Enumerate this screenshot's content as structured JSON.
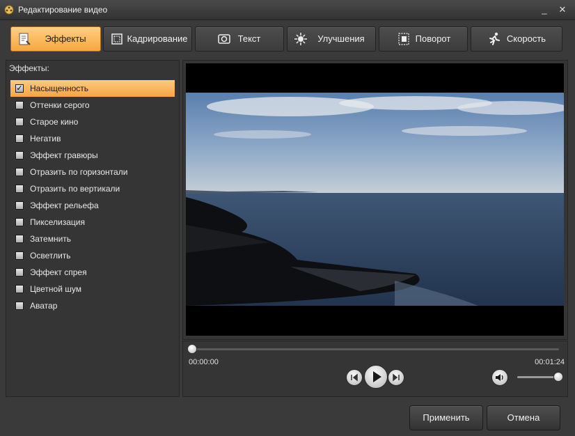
{
  "window": {
    "title": "Редактирование видео",
    "app_icon": "film-reel-icon",
    "minimize_glyph": "_",
    "close_glyph": "✕"
  },
  "tabs": [
    {
      "label": "Эффекты",
      "icon": "effects-icon",
      "active": true
    },
    {
      "label": "Кадрирование",
      "icon": "crop-icon",
      "active": false
    },
    {
      "label": "Текст",
      "icon": "text-icon",
      "active": false
    },
    {
      "label": "Улучшения",
      "icon": "brightness-icon",
      "active": false
    },
    {
      "label": "Поворот",
      "icon": "rotate-icon",
      "active": false
    },
    {
      "label": "Скорость",
      "icon": "running-man-icon",
      "active": false
    }
  ],
  "effects_panel": {
    "title": "Эффекты:",
    "items": [
      {
        "label": "Насыщенность",
        "checked": true,
        "selected": true
      },
      {
        "label": "Оттенки серого",
        "checked": false,
        "selected": false
      },
      {
        "label": "Старое кино",
        "checked": false,
        "selected": false
      },
      {
        "label": "Негатив",
        "checked": false,
        "selected": false
      },
      {
        "label": "Эффект гравюры",
        "checked": false,
        "selected": false
      },
      {
        "label": "Отразить по горизонтали",
        "checked": false,
        "selected": false
      },
      {
        "label": "Отразить по вертикали",
        "checked": false,
        "selected": false
      },
      {
        "label": "Эффект рельефа",
        "checked": false,
        "selected": false
      },
      {
        "label": "Пикселизация",
        "checked": false,
        "selected": false
      },
      {
        "label": "Затемнить",
        "checked": false,
        "selected": false
      },
      {
        "label": "Осветлить",
        "checked": false,
        "selected": false
      },
      {
        "label": "Эффект спрея",
        "checked": false,
        "selected": false
      },
      {
        "label": "Цветной шум",
        "checked": false,
        "selected": false
      },
      {
        "label": "Аватар",
        "checked": false,
        "selected": false
      }
    ]
  },
  "player": {
    "current_time": "00:00:00",
    "total_time": "00:01:24",
    "progress": 0,
    "volume": 1.0
  },
  "buttons": {
    "apply": "Применить",
    "cancel": "Отмена"
  },
  "colors": {
    "accent": "#f6a73f",
    "background": "#3a3a3a"
  }
}
